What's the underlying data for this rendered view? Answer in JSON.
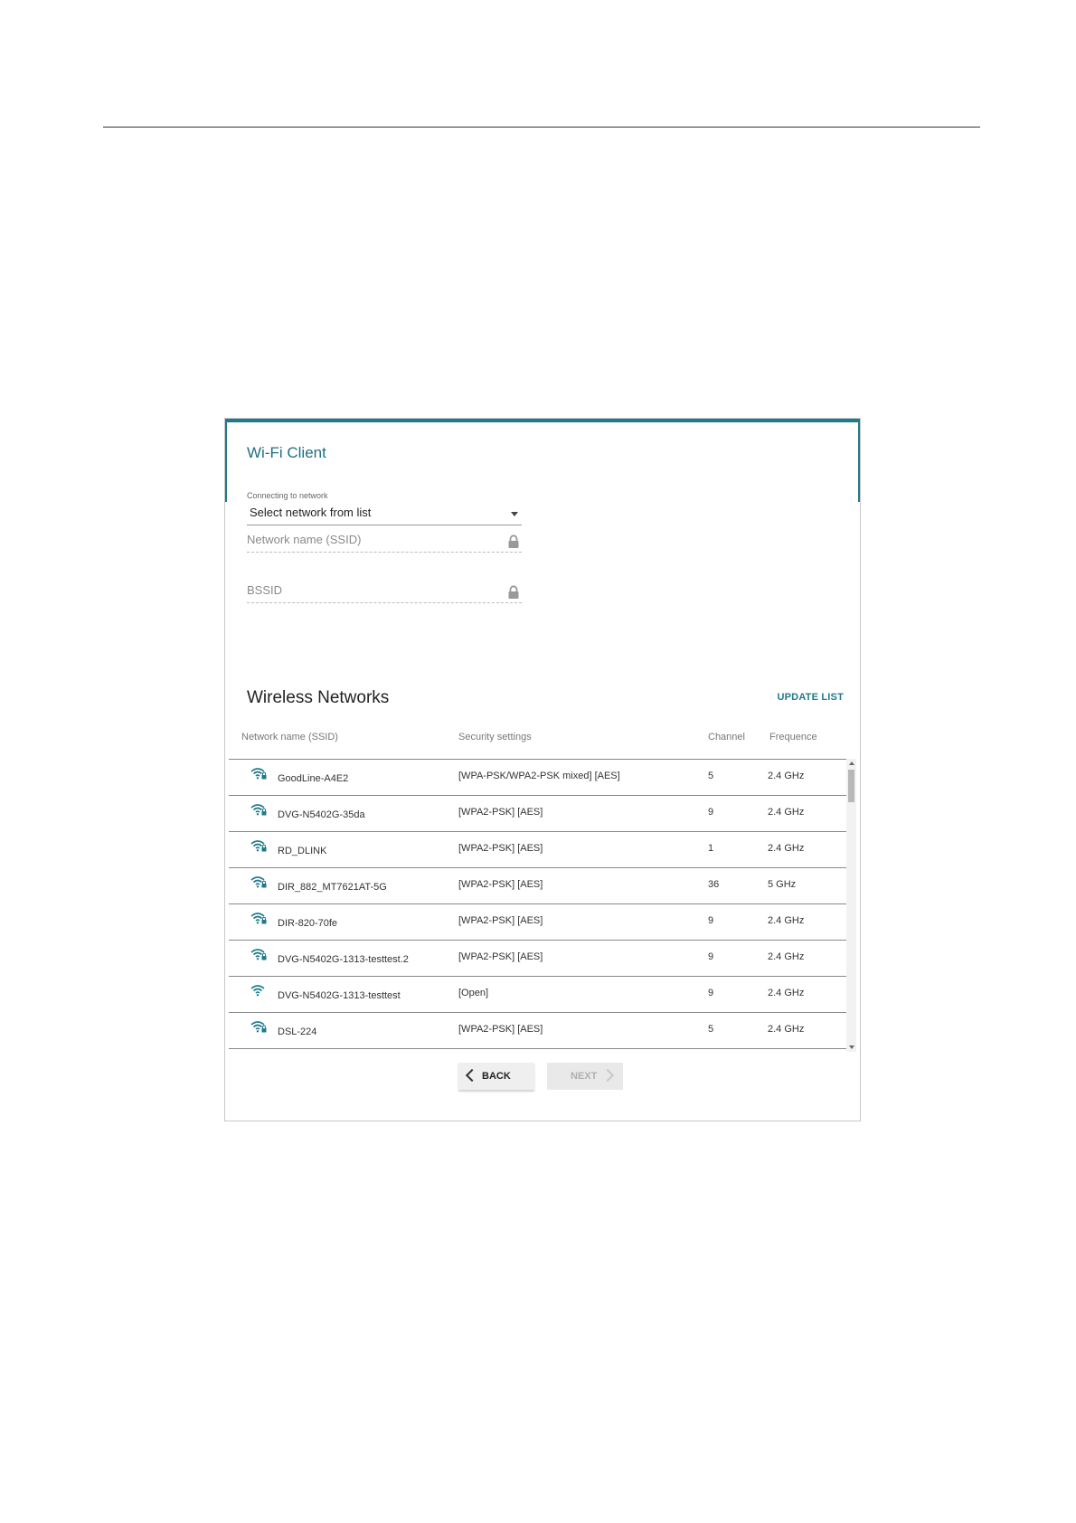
{
  "page": {
    "window_title": "Wi-Fi Client",
    "connect": {
      "label": "Connecting to network",
      "value": "Select network from list"
    },
    "ssid_field": {
      "placeholder": "Network name (SSID)"
    },
    "bssid_field": {
      "placeholder": "BSSID"
    },
    "wireless": {
      "title": "Wireless Networks",
      "update_label": "UPDATE LIST",
      "columns": [
        "Network name (SSID)",
        "Security settings",
        "Channel",
        "Frequence"
      ],
      "rows": [
        {
          "ssid": "GoodLine-A4E2",
          "security": "[WPA-PSK/WPA2-PSK mixed] [AES]",
          "channel": "5",
          "freq": "2.4 GHz",
          "icon": "wifi-lock-icon"
        },
        {
          "ssid": "DVG-N5402G-35da",
          "security": "[WPA2-PSK] [AES]",
          "channel": "9",
          "freq": "2.4 GHz",
          "icon": "wifi-lock-icon"
        },
        {
          "ssid": "RD_DLINK",
          "security": "[WPA2-PSK] [AES]",
          "channel": "1",
          "freq": "2.4 GHz",
          "icon": "wifi-lock-icon"
        },
        {
          "ssid": "DIR_882_MT7621AT-5G",
          "security": "[WPA2-PSK] [AES]",
          "channel": "36",
          "freq": "5 GHz",
          "icon": "wifi-lock-icon"
        },
        {
          "ssid": "DIR-820-70fe",
          "security": "[WPA2-PSK] [AES]",
          "channel": "9",
          "freq": "2.4 GHz",
          "icon": "wifi-lock-icon"
        },
        {
          "ssid": "DVG-N5402G-1313-testtest.2",
          "security": "[WPA2-PSK] [AES]",
          "channel": "9",
          "freq": "2.4 GHz",
          "icon": "wifi-lock-icon"
        },
        {
          "ssid": "DVG-N5402G-1313-testtest",
          "security": "[Open]",
          "channel": "9",
          "freq": "2.4 GHz",
          "icon": "wifi-icon"
        },
        {
          "ssid": "DSL-224",
          "security": "[WPA2-PSK] [AES]",
          "channel": "5",
          "freq": "2.4 GHz",
          "icon": "wifi-lock-icon"
        }
      ]
    },
    "buttons": {
      "back_label": "BACK",
      "next_label": "NEXT"
    },
    "colors": {
      "accent": "#1f7a8c",
      "title": "#1f6f80"
    }
  }
}
